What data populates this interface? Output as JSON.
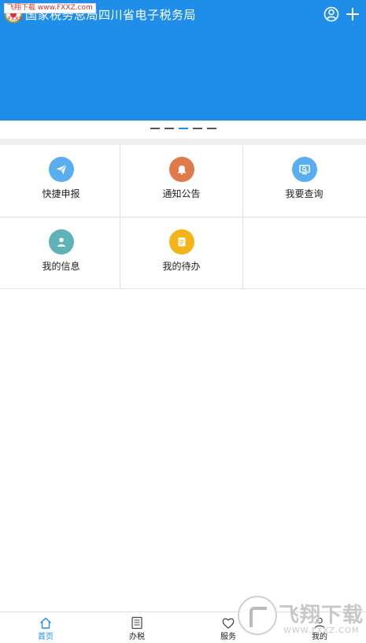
{
  "header": {
    "title": "国家税务总局四川省电子税务局",
    "watermark_line1": "飞翔下载 www.FXXZ.com",
    "watermark_line2": "FXXZ"
  },
  "banner": {
    "color": "#1e8ee8",
    "dot_count": 5,
    "active_dot": 2
  },
  "grid": {
    "items": [
      {
        "label": "快捷申报",
        "icon": "paper-plane-icon",
        "color": "#5aaef0"
      },
      {
        "label": "通知公告",
        "icon": "bell-icon",
        "color": "#e07a4a"
      },
      {
        "label": "我要查询",
        "icon": "monitor-search-icon",
        "color": "#5aaef0"
      },
      {
        "label": "我的信息",
        "icon": "user-icon",
        "color": "#5fb3b8"
      },
      {
        "label": "我的待办",
        "icon": "clipboard-icon",
        "color": "#f2b418"
      }
    ]
  },
  "tabbar": {
    "tabs": [
      {
        "label": "首页",
        "icon": "home-icon",
        "active": true
      },
      {
        "label": "办税",
        "icon": "list-icon",
        "active": false
      },
      {
        "label": "服务",
        "icon": "heart-icon",
        "active": false
      },
      {
        "label": "我的",
        "icon": "person-icon",
        "active": false
      }
    ],
    "active_color": "#1e8ee8"
  },
  "watermark": {
    "brand": "飞翔下载",
    "url": "WWW.FXXZ.COM"
  }
}
